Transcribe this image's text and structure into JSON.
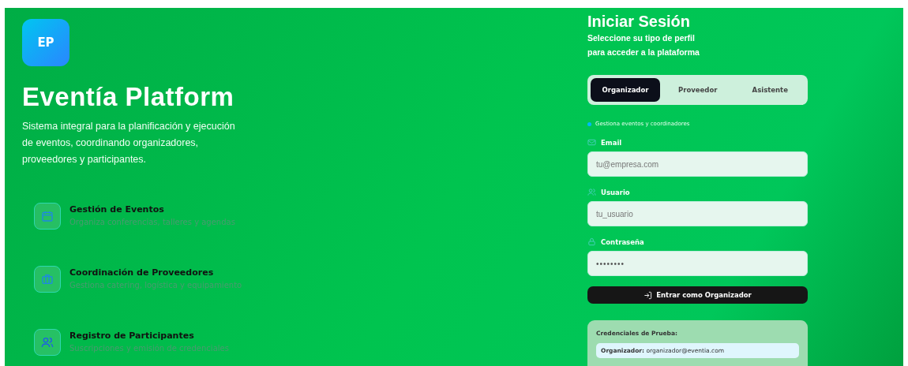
{
  "brand": {
    "logo": "EP",
    "title": "Eventía Platform",
    "description": "Sistema integral para la planificación y ejecución de eventos, coordinando organizadores, proveedores y participantes."
  },
  "features": [
    {
      "kind": "calendar",
      "title": "Gestión de Eventos",
      "subtitle": "Organiza conferencias, talleres y agendas"
    },
    {
      "kind": "briefcase",
      "title": "Coordinación de Proveedores",
      "subtitle": "Gestiona catering, logística y equipamiento"
    },
    {
      "kind": "users",
      "title": "Registro de Participantes",
      "subtitle": "Suscripciones y emisión de credenciales"
    }
  ],
  "login": {
    "title": "Iniciar Sesión",
    "subtitle": [
      "Seleccione su tipo de perfil",
      "para acceder a la plataforma"
    ],
    "tabs": [
      {
        "label": "Organizador",
        "selected": true
      },
      {
        "label": "Proveedor",
        "selected": false
      },
      {
        "label": "Asistente",
        "selected": false
      }
    ],
    "hint": "Gestiona eventos y coordinadores",
    "fields": [
      {
        "kind": "mail",
        "label": "Email",
        "placeholder": "tu@empresa.com"
      },
      {
        "kind": "user",
        "label": "Usuario",
        "placeholder": "tu_usuario"
      },
      {
        "kind": "lock",
        "label": "Contraseña",
        "value": "••••••••"
      }
    ],
    "submit": "Entrar como Organizador",
    "credentials": {
      "title": "Credenciales de Prueba:",
      "items": [
        "**Organizador:** organizador@eventia.com"
      ]
    }
  }
}
